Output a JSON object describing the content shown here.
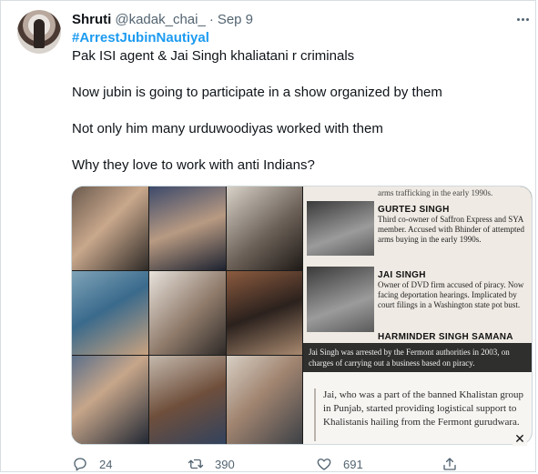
{
  "tweet": {
    "author_name": "Shruti",
    "author_handle": "@kadak_chai_",
    "separator": "·",
    "date": "Sep 9",
    "hashtag": "#ArrestJubinNautiyal",
    "lines": [
      "Pak ISI agent & Jai Singh khaliatani  r criminals",
      "",
      "Now jubin is going to participate in a show organized by them",
      "",
      "Not only him many urduwoodiyas worked with them",
      "",
      "Why they love to work with anti Indians?"
    ]
  },
  "media": {
    "article": {
      "top_text": "arms trafficking in the early 1990s.",
      "entries": [
        {
          "name": "GURTEJ SINGH",
          "text": "Third co-owner of Saffron Express and SYA member. Accused with Bhinder of attempted arms buying in the early 1990s."
        },
        {
          "name": "JAI SINGH",
          "text": "Owner of DVD firm accused of piracy. Now facing deportation hearings. Implicated by court filings in a Washington state pot bust."
        },
        {
          "name": "HARMINDER SINGH SAMANA",
          "text": ""
        }
      ],
      "caption": "Jai Singh was arrested by the Fermont authorities in 2003, on charges of carrying out a business based on piracy.",
      "quote": "Jai, who was a part of the banned Khalistan group in Punjab, started providing logistical support to Khalistanis hailing from the Fermont gurudwara.",
      "close_label": "✕"
    }
  },
  "actions": {
    "reply_count": "24",
    "retweet_count": "390",
    "like_count": "691"
  },
  "icons": {
    "more": "more-icon",
    "reply": "reply-icon",
    "retweet": "retweet-icon",
    "like": "like-icon",
    "share": "share-icon"
  },
  "colors": {
    "link": "#1d9bf0",
    "secondary_text": "#536471",
    "primary_text": "#0f1419"
  }
}
